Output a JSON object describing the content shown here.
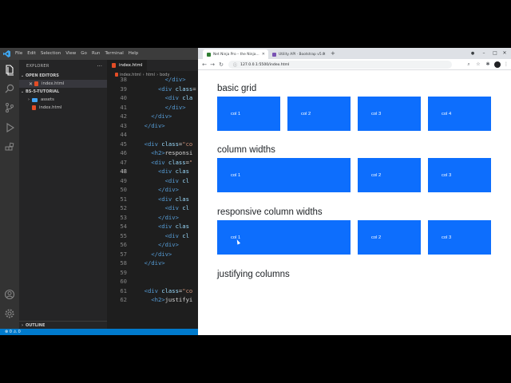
{
  "vscode": {
    "menu": [
      "File",
      "Edit",
      "Selection",
      "View",
      "Go",
      "Run",
      "Terminal",
      "Help"
    ],
    "explorer_title": "EXPLORER",
    "explorer_more": "···",
    "open_editors_label": "OPEN EDITORS",
    "open_editor_file": "index.html",
    "workspace_label": "BS-5-TUTORIAL",
    "tree": [
      {
        "name": "assets",
        "type": "folder"
      },
      {
        "name": "index.html",
        "type": "html"
      }
    ],
    "outline_label": "OUTLINE",
    "tab_label": "index.html",
    "breadcrumbs": [
      "index.html",
      "html",
      "body"
    ],
    "code": [
      {
        "n": "38",
        "parts": [
          [
            "cd",
            "        "
          ],
          [
            "tagname",
            "</div>"
          ]
        ]
      },
      {
        "n": "39",
        "parts": [
          [
            "cd",
            "      "
          ],
          [
            "tagname",
            "<div"
          ],
          [
            "attr",
            " class"
          ],
          [
            "txt",
            "="
          ]
        ]
      },
      {
        "n": "40",
        "parts": [
          [
            "cd",
            "        "
          ],
          [
            "tagname",
            "<div"
          ],
          [
            "attr",
            " cla"
          ]
        ]
      },
      {
        "n": "41",
        "parts": [
          [
            "cd",
            "        "
          ],
          [
            "tagname",
            "</div>"
          ]
        ]
      },
      {
        "n": "42",
        "parts": [
          [
            "cd",
            "    "
          ],
          [
            "tagname",
            "</div>"
          ]
        ]
      },
      {
        "n": "43",
        "parts": [
          [
            "cd",
            "  "
          ],
          [
            "tagname",
            "</div>"
          ]
        ]
      },
      {
        "n": "44",
        "parts": []
      },
      {
        "n": "45",
        "parts": [
          [
            "cd",
            "  "
          ],
          [
            "tagname",
            "<div"
          ],
          [
            "attr",
            " class"
          ],
          [
            "txt",
            "="
          ],
          [
            "strv",
            "\"co"
          ]
        ]
      },
      {
        "n": "46",
        "parts": [
          [
            "cd",
            "    "
          ],
          [
            "tagname",
            "<h2>"
          ],
          [
            "txt",
            "responsi"
          ]
        ]
      },
      {
        "n": "47",
        "parts": [
          [
            "cd",
            "    "
          ],
          [
            "tagname",
            "<div"
          ],
          [
            "attr",
            " class"
          ],
          [
            "txt",
            "="
          ],
          [
            "strv",
            "\""
          ]
        ]
      },
      {
        "n": "48",
        "parts": [
          [
            "cd",
            "      "
          ],
          [
            "tagname",
            "<div"
          ],
          [
            "attr",
            " clas"
          ]
        ]
      },
      {
        "n": "49",
        "parts": [
          [
            "cd",
            "        "
          ],
          [
            "tagname",
            "<div"
          ],
          [
            "attr",
            " cl"
          ]
        ]
      },
      {
        "n": "50",
        "parts": [
          [
            "cd",
            "      "
          ],
          [
            "tagname",
            "</div>"
          ]
        ]
      },
      {
        "n": "51",
        "parts": [
          [
            "cd",
            "      "
          ],
          [
            "tagname",
            "<div"
          ],
          [
            "attr",
            " clas"
          ]
        ]
      },
      {
        "n": "52",
        "parts": [
          [
            "cd",
            "        "
          ],
          [
            "tagname",
            "<div"
          ],
          [
            "attr",
            " cl"
          ]
        ]
      },
      {
        "n": "53",
        "parts": [
          [
            "cd",
            "      "
          ],
          [
            "tagname",
            "</div>"
          ]
        ]
      },
      {
        "n": "54",
        "parts": [
          [
            "cd",
            "      "
          ],
          [
            "tagname",
            "<div"
          ],
          [
            "attr",
            " clas"
          ]
        ]
      },
      {
        "n": "55",
        "parts": [
          [
            "cd",
            "        "
          ],
          [
            "tagname",
            "<div"
          ],
          [
            "attr",
            " cl"
          ]
        ]
      },
      {
        "n": "56",
        "parts": [
          [
            "cd",
            "      "
          ],
          [
            "tagname",
            "</div>"
          ]
        ]
      },
      {
        "n": "57",
        "parts": [
          [
            "cd",
            "    "
          ],
          [
            "tagname",
            "</div>"
          ]
        ]
      },
      {
        "n": "58",
        "parts": [
          [
            "cd",
            "  "
          ],
          [
            "tagname",
            "</div>"
          ]
        ]
      },
      {
        "n": "59",
        "parts": []
      },
      {
        "n": "60",
        "parts": []
      },
      {
        "n": "61",
        "parts": [
          [
            "cd",
            "  "
          ],
          [
            "tagname",
            "<div"
          ],
          [
            "attr",
            " class"
          ],
          [
            "txt",
            "="
          ],
          [
            "strv",
            "\"co"
          ]
        ]
      },
      {
        "n": "62",
        "parts": [
          [
            "cd",
            "    "
          ],
          [
            "tagname",
            "<h2>"
          ],
          [
            "txt",
            "justifyi"
          ]
        ]
      }
    ],
    "active_line": "48",
    "status_left": "⊗ 0 ⚠ 0",
    "colors": {
      "bg": "#1e1e1e",
      "activity": "#333333",
      "sidebar": "#252526",
      "status": "#007acc"
    }
  },
  "chrome": {
    "tabs": [
      {
        "title": "Net Ninja Pro – the Ninja...",
        "favicon_color": "#2e7d32"
      },
      {
        "title": "Utility API · Bootstrap v5.0",
        "favicon_color": "#7952b3"
      }
    ],
    "new_tab": "+",
    "url": "127.0.0.1:5500/index.html",
    "page": {
      "sections": [
        {
          "heading": "basic grid",
          "cols": [
            "col 1",
            "col 2",
            "col 3",
            "col 4"
          ]
        },
        {
          "heading": "column widths",
          "cols": [
            "col 1",
            "col 2",
            "col 3"
          ]
        },
        {
          "heading": "responsive column widths",
          "cols": [
            "col 1",
            "col 2",
            "col 3"
          ]
        },
        {
          "heading": "justifying columns",
          "cols": []
        }
      ],
      "accent": "#0d6efd"
    }
  }
}
